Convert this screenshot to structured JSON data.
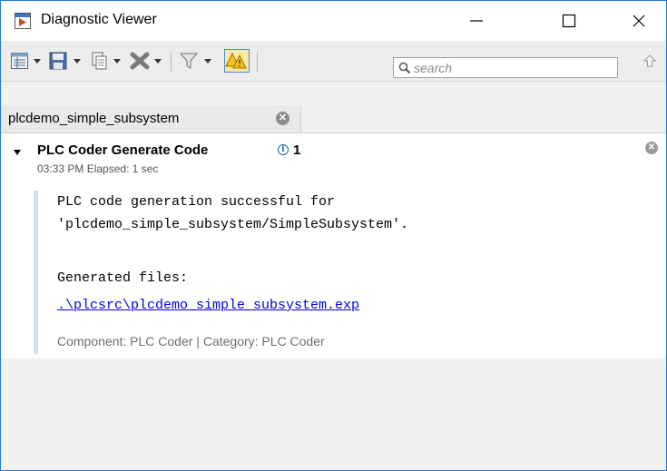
{
  "window": {
    "title": "Diagnostic Viewer"
  },
  "titlebar_buttons": [
    "minimize",
    "maximize",
    "close"
  ],
  "toolbar": {
    "icons": [
      "report-icon",
      "save-icon",
      "copy-icon",
      "delete-icon",
      "filter-icon",
      "warning-toggle-icon",
      "search-icon",
      "up-arrow-icon"
    ],
    "search_placeholder": "search"
  },
  "tab": {
    "label": "plcdemo_simple_subsystem"
  },
  "diagnostic": {
    "title": "PLC Coder Generate Code",
    "info_count": "1",
    "timestamp": "03:33 PM  Elapsed: 1 sec",
    "message_line1": "PLC code generation successful for",
    "message_line2": "'plcdemo_simple_subsystem/SimpleSubsystem'.",
    "generated_label": "Generated files:",
    "file_link": ".\\plcsrc\\plcdemo_simple_subsystem.exp",
    "component_info": "Component: PLC Coder | Category: PLC Coder"
  },
  "colors": {
    "window_border": "#1e7bd2",
    "link": "#0000ee",
    "info_icon": "#1565c0",
    "message_bar": "#cfe0ee"
  }
}
